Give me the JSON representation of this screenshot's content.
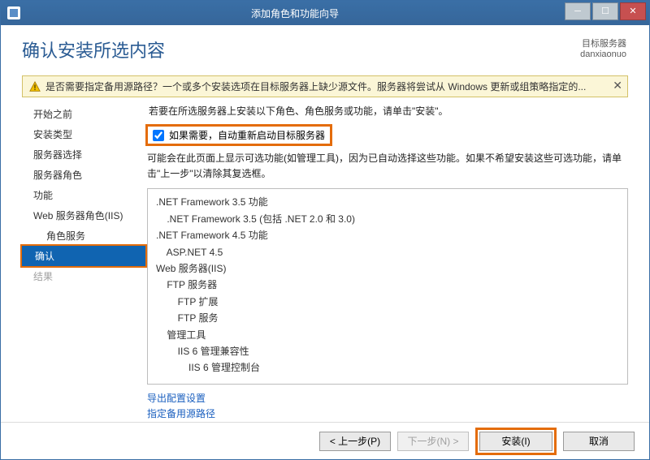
{
  "window": {
    "title": "添加角色和功能向导"
  },
  "header": {
    "page_title": "确认安装所选内容",
    "server_label": "目标服务器",
    "server_name": "danxiaonuo"
  },
  "warning": {
    "text": "是否需要指定备用源路径？一个或多个安装选项在目标服务器上缺少源文件。服务器将尝试从 Windows 更新或组策略指定的..."
  },
  "sidebar": {
    "items": [
      {
        "label": "开始之前"
      },
      {
        "label": "安装类型"
      },
      {
        "label": "服务器选择"
      },
      {
        "label": "服务器角色"
      },
      {
        "label": "功能"
      },
      {
        "label": "Web 服务器角色(IIS)"
      },
      {
        "label": "角色服务"
      },
      {
        "label": "确认"
      },
      {
        "label": "结果"
      }
    ]
  },
  "main": {
    "instr": "若要在所选服务器上安装以下角色、角色服务或功能，请单击\"安装\"。",
    "checkbox_label": "如果需要，自动重新启动目标服务器",
    "checkbox_checked": true,
    "explain": "可能会在此页面上显示可选功能(如管理工具)，因为已自动选择这些功能。如果不希望安装这些可选功能，请单击\"上一步\"以清除其复选框。",
    "features": [
      {
        "indent": 0,
        "label": ".NET Framework 3.5 功能"
      },
      {
        "indent": 1,
        "label": ".NET Framework 3.5 (包括 .NET 2.0 和 3.0)"
      },
      {
        "indent": 0,
        "label": ".NET Framework 4.5 功能"
      },
      {
        "indent": 1,
        "label": "ASP.NET 4.5"
      },
      {
        "indent": 0,
        "label": "Web 服务器(IIS)"
      },
      {
        "indent": 1,
        "label": "FTP 服务器"
      },
      {
        "indent": 2,
        "label": "FTP 扩展"
      },
      {
        "indent": 2,
        "label": "FTP 服务"
      },
      {
        "indent": 1,
        "label": "管理工具"
      },
      {
        "indent": 2,
        "label": "IIS 6 管理兼容性"
      },
      {
        "indent": 3,
        "label": "IIS 6 管理控制台"
      }
    ],
    "link_export": "导出配置设置",
    "link_altsrc": "指定备用源路径"
  },
  "footer": {
    "prev": "< 上一步(P)",
    "next": "下一步(N) >",
    "install": "安装(I)",
    "cancel": "取消"
  }
}
